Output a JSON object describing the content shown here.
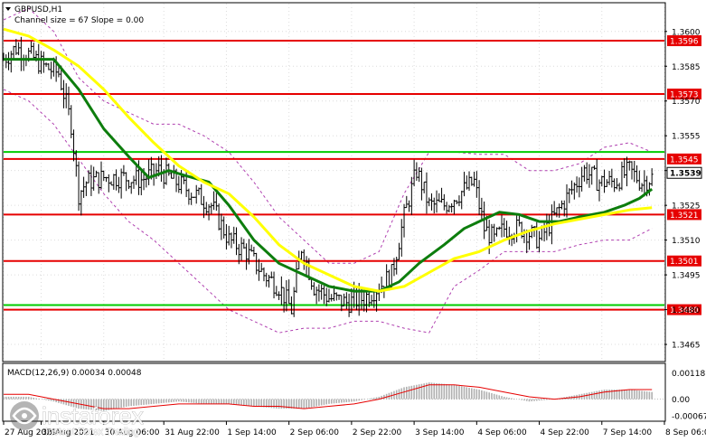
{
  "header": {
    "symbol": "GBPUSD,H1",
    "indicator": "Channel size = 67 Slope = 0.00"
  },
  "macd": {
    "label": "MACD(12,26,9) 0.00034 0.00048",
    "yticks": [
      {
        "v": 0.0011,
        "label": "0.00118"
      },
      {
        "v": 0.0,
        "label": "0.00"
      },
      {
        "v": -0.0007,
        "label": "-0.00067"
      }
    ]
  },
  "logo": {
    "brand": "instaforex",
    "tagline": "Instant Forex Trading"
  },
  "chart_data": {
    "type": "line",
    "ylim": [
      1.3458,
      1.3612
    ],
    "yticks": [
      1.36,
      1.3585,
      1.357,
      1.3555,
      1.354,
      1.3525,
      1.351,
      1.3495,
      1.348,
      1.3465
    ],
    "ytick_labels": [
      "1.3600",
      "1.3585",
      "1.3570",
      "1.3555",
      "1.3540",
      "1.3525",
      "1.3510",
      "1.3495",
      "1.3480",
      "1.3465"
    ],
    "xticks": [
      {
        "i": 0,
        "label": "27 Aug 2021"
      },
      {
        "i": 15,
        "label": "30 Aug 2021"
      },
      {
        "i": 40,
        "label": "30 Aug 06:00"
      },
      {
        "i": 64,
        "label": "31 Aug 22:00"
      },
      {
        "i": 89,
        "label": "1 Sep 14:00"
      },
      {
        "i": 114,
        "label": "2 Sep 06:00"
      },
      {
        "i": 139,
        "label": "2 Sep 22:00"
      },
      {
        "i": 164,
        "label": "3 Sep 14:00"
      },
      {
        "i": 189,
        "label": "4 Sep 06:00"
      },
      {
        "i": 214,
        "label": "4 Sep 22:00"
      },
      {
        "i": 239,
        "label": "7 Sep 14:00"
      },
      {
        "i": 264,
        "label": "8 Sep 06:00"
      }
    ],
    "levels": [
      {
        "value": 1.3596,
        "color": "#e60000",
        "label": "1.3596"
      },
      {
        "value": 1.3573,
        "color": "#e60000",
        "label": "1.3573"
      },
      {
        "value": 1.3548,
        "color": "#00cc00",
        "label": ""
      },
      {
        "value": 1.3545,
        "color": "#e60000",
        "label": "1.3545"
      },
      {
        "value": 1.3521,
        "color": "#e60000",
        "label": "1.3521"
      },
      {
        "value": 1.3501,
        "color": "#e60000",
        "label": "1.3501"
      },
      {
        "value": 1.3482,
        "color": "#00cc00",
        "label": ""
      },
      {
        "value": 1.348,
        "color": "#e60000",
        "label": "1.3480"
      }
    ],
    "current_price": {
      "value": 1.3539,
      "label": "1.3539"
    },
    "series": [
      {
        "style": "bars",
        "color": "#000000",
        "anchors": [
          [
            0,
            1.3588
          ],
          [
            5,
            1.3593
          ],
          [
            10,
            1.359
          ],
          [
            16,
            1.3585
          ],
          [
            22,
            1.3582
          ],
          [
            27,
            1.356
          ],
          [
            30,
            1.353
          ],
          [
            33,
            1.3535
          ],
          [
            40,
            1.3537
          ],
          [
            48,
            1.3537
          ],
          [
            55,
            1.3536
          ],
          [
            62,
            1.354
          ],
          [
            69,
            1.3535
          ],
          [
            76,
            1.353
          ],
          [
            83,
            1.3525
          ],
          [
            90,
            1.351
          ],
          [
            97,
            1.3505
          ],
          [
            104,
            1.3495
          ],
          [
            110,
            1.349
          ],
          [
            115,
            1.348
          ],
          [
            119,
            1.3507
          ],
          [
            124,
            1.349
          ],
          [
            130,
            1.3485
          ],
          [
            137,
            1.3483
          ],
          [
            144,
            1.3485
          ],
          [
            150,
            1.349
          ],
          [
            155,
            1.3495
          ],
          [
            160,
            1.352
          ],
          [
            165,
            1.354
          ],
          [
            170,
            1.3525
          ],
          [
            176,
            1.3525
          ],
          [
            182,
            1.353
          ],
          [
            188,
            1.3535
          ],
          [
            192,
            1.3515
          ],
          [
            196,
            1.351
          ],
          [
            200,
            1.3515
          ],
          [
            207,
            1.3515
          ],
          [
            214,
            1.351
          ],
          [
            220,
            1.352
          ],
          [
            226,
            1.353
          ],
          [
            232,
            1.354
          ],
          [
            238,
            1.3535
          ],
          [
            244,
            1.3535
          ],
          [
            250,
            1.354
          ],
          [
            255,
            1.3535
          ],
          [
            259,
            1.3537
          ]
        ]
      },
      {
        "style": "ma",
        "color": "#0d7d0d",
        "values": [
          [
            0,
            1.3588
          ],
          [
            10,
            1.3588
          ],
          [
            20,
            1.3588
          ],
          [
            30,
            1.3575
          ],
          [
            40,
            1.3558
          ],
          [
            50,
            1.3546
          ],
          [
            58,
            1.3537
          ],
          [
            66,
            1.354
          ],
          [
            72,
            1.3538
          ],
          [
            82,
            1.3535
          ],
          [
            90,
            1.3525
          ],
          [
            100,
            1.351
          ],
          [
            110,
            1.35
          ],
          [
            120,
            1.3495
          ],
          [
            130,
            1.349
          ],
          [
            140,
            1.3488
          ],
          [
            150,
            1.3488
          ],
          [
            158,
            1.3492
          ],
          [
            166,
            1.35
          ],
          [
            176,
            1.3508
          ],
          [
            184,
            1.3515
          ],
          [
            192,
            1.3519
          ],
          [
            198,
            1.3522
          ],
          [
            206,
            1.3521
          ],
          [
            214,
            1.3518
          ],
          [
            222,
            1.3518
          ],
          [
            230,
            1.352
          ],
          [
            240,
            1.3522
          ],
          [
            248,
            1.3525
          ],
          [
            254,
            1.3528
          ],
          [
            259,
            1.3532
          ]
        ]
      },
      {
        "style": "ma",
        "color": "#ffff00",
        "values": [
          [
            0,
            1.3601
          ],
          [
            10,
            1.3598
          ],
          [
            20,
            1.3592
          ],
          [
            30,
            1.3585
          ],
          [
            40,
            1.3575
          ],
          [
            50,
            1.3563
          ],
          [
            60,
            1.3552
          ],
          [
            70,
            1.3542
          ],
          [
            80,
            1.3535
          ],
          [
            90,
            1.353
          ],
          [
            100,
            1.352
          ],
          [
            110,
            1.3508
          ],
          [
            120,
            1.35
          ],
          [
            130,
            1.3495
          ],
          [
            140,
            1.349
          ],
          [
            150,
            1.3488
          ],
          [
            160,
            1.349
          ],
          [
            170,
            1.3496
          ],
          [
            180,
            1.3502
          ],
          [
            190,
            1.3505
          ],
          [
            200,
            1.351
          ],
          [
            210,
            1.3514
          ],
          [
            220,
            1.3517
          ],
          [
            230,
            1.3519
          ],
          [
            240,
            1.3521
          ],
          [
            250,
            1.3523
          ],
          [
            259,
            1.3524
          ]
        ]
      },
      {
        "style": "channel",
        "color": "#b040b0",
        "values_upper": [
          [
            0,
            1.3605
          ],
          [
            10,
            1.361
          ],
          [
            20,
            1.36
          ],
          [
            30,
            1.358
          ],
          [
            40,
            1.357
          ],
          [
            50,
            1.3565
          ],
          [
            60,
            1.356
          ],
          [
            70,
            1.356
          ],
          [
            80,
            1.3555
          ],
          [
            90,
            1.3548
          ],
          [
            100,
            1.3535
          ],
          [
            110,
            1.352
          ],
          [
            120,
            1.351
          ],
          [
            130,
            1.35
          ],
          [
            140,
            1.35
          ],
          [
            150,
            1.3505
          ],
          [
            160,
            1.353
          ],
          [
            170,
            1.3548
          ],
          [
            180,
            1.3548
          ],
          [
            190,
            1.3547
          ],
          [
            200,
            1.3547
          ],
          [
            210,
            1.354
          ],
          [
            220,
            1.354
          ],
          [
            230,
            1.3543
          ],
          [
            240,
            1.355
          ],
          [
            250,
            1.3552
          ],
          [
            259,
            1.3548
          ]
        ],
        "values_lower": [
          [
            0,
            1.3575
          ],
          [
            10,
            1.357
          ],
          [
            20,
            1.356
          ],
          [
            30,
            1.3545
          ],
          [
            40,
            1.353
          ],
          [
            50,
            1.3518
          ],
          [
            60,
            1.351
          ],
          [
            70,
            1.35
          ],
          [
            80,
            1.349
          ],
          [
            90,
            1.348
          ],
          [
            100,
            1.3475
          ],
          [
            110,
            1.347
          ],
          [
            120,
            1.3472
          ],
          [
            130,
            1.3472
          ],
          [
            140,
            1.3475
          ],
          [
            150,
            1.3475
          ],
          [
            160,
            1.3472
          ],
          [
            170,
            1.347
          ],
          [
            180,
            1.349
          ],
          [
            190,
            1.3497
          ],
          [
            200,
            1.3505
          ],
          [
            210,
            1.3505
          ],
          [
            220,
            1.3505
          ],
          [
            230,
            1.3508
          ],
          [
            240,
            1.351
          ],
          [
            250,
            1.351
          ],
          [
            259,
            1.3515
          ]
        ]
      }
    ],
    "macd_hist": [
      [
        0,
        0.0001
      ],
      [
        10,
        0.0001
      ],
      [
        20,
        -0.0001
      ],
      [
        30,
        -0.0004
      ],
      [
        40,
        -0.0005
      ],
      [
        50,
        -0.0003
      ],
      [
        60,
        -0.0002
      ],
      [
        70,
        -0.0001
      ],
      [
        80,
        -0.0002
      ],
      [
        90,
        -0.0002
      ],
      [
        100,
        -0.0003
      ],
      [
        110,
        -0.0004
      ],
      [
        120,
        -0.0004
      ],
      [
        130,
        -0.0002
      ],
      [
        140,
        -0.0001
      ],
      [
        150,
        0.0001
      ],
      [
        160,
        0.0005
      ],
      [
        170,
        0.0007
      ],
      [
        180,
        0.0006
      ],
      [
        190,
        0.0004
      ],
      [
        200,
        0.0001
      ],
      [
        210,
        -0.0001
      ],
      [
        220,
        0.0
      ],
      [
        230,
        0.0002
      ],
      [
        240,
        0.0004
      ],
      [
        250,
        0.0004
      ],
      [
        259,
        0.0003
      ]
    ],
    "macd_signal": [
      [
        0,
        0.0002
      ],
      [
        10,
        0.0002
      ],
      [
        20,
        0.0
      ],
      [
        30,
        -0.0002
      ],
      [
        40,
        -0.0004
      ],
      [
        50,
        -0.0004
      ],
      [
        60,
        -0.0003
      ],
      [
        70,
        -0.0002
      ],
      [
        80,
        -0.0002
      ],
      [
        90,
        -0.0002
      ],
      [
        100,
        -0.0003
      ],
      [
        110,
        -0.0003
      ],
      [
        120,
        -0.0004
      ],
      [
        130,
        -0.0003
      ],
      [
        140,
        -0.0002
      ],
      [
        150,
        0.0
      ],
      [
        160,
        0.0003
      ],
      [
        170,
        0.0006
      ],
      [
        180,
        0.0006
      ],
      [
        190,
        0.0005
      ],
      [
        200,
        0.0003
      ],
      [
        210,
        0.0001
      ],
      [
        220,
        0.0
      ],
      [
        230,
        0.0001
      ],
      [
        240,
        0.0003
      ],
      [
        250,
        0.0004
      ],
      [
        259,
        0.0004
      ]
    ],
    "colors": {
      "hist": "#b0b0b0",
      "signal": "#e60000",
      "grid": "#dcdcdc",
      "macd_zero": "#808080"
    }
  }
}
